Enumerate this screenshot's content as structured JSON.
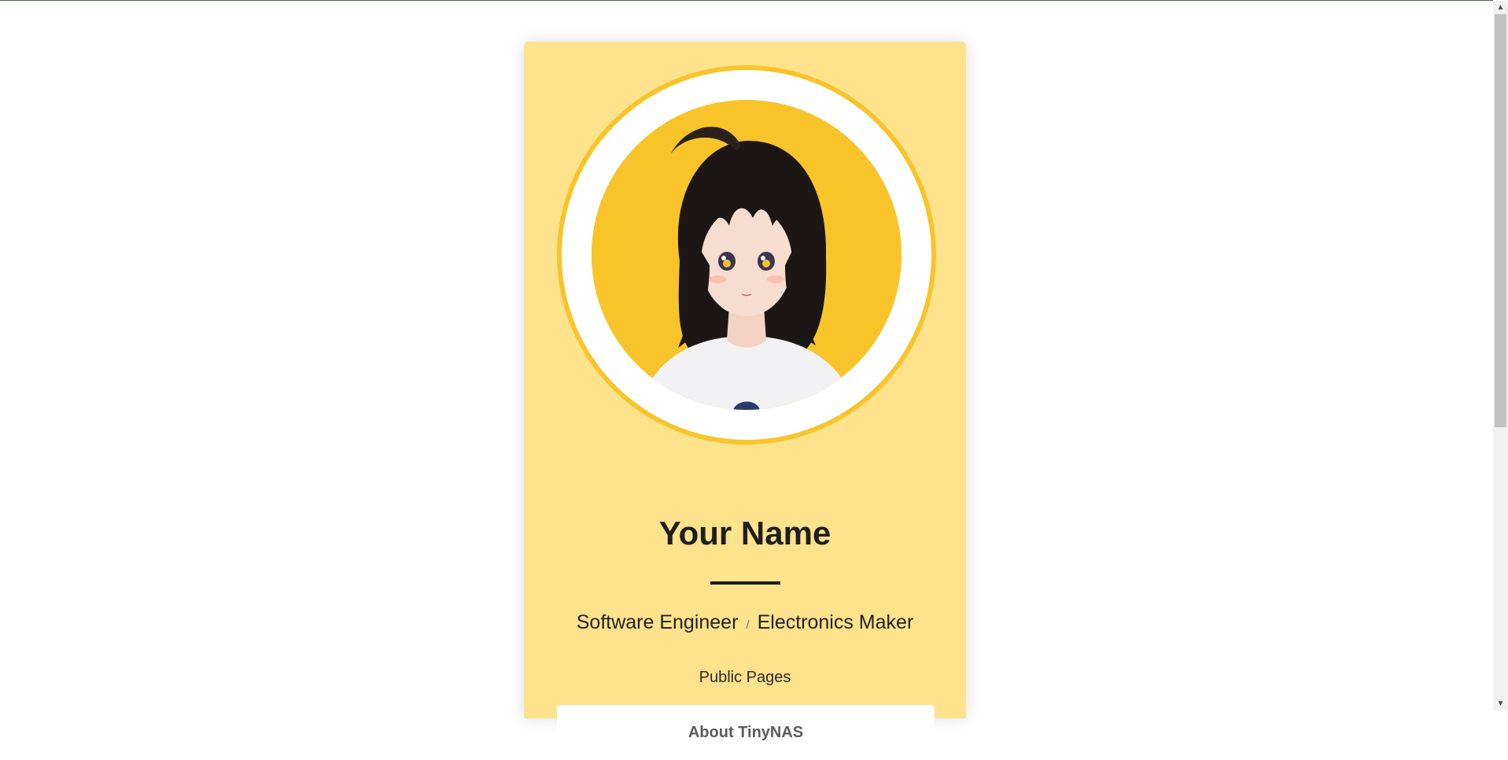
{
  "profile": {
    "name": "Your Name",
    "roles": [
      "Software Engineer",
      "Electronics Maker"
    ],
    "role_separator": "/",
    "avatar": "anime-girl-portrait"
  },
  "public_pages": {
    "heading": "Public Pages",
    "links": [
      {
        "label": "About TinyNAS"
      }
    ]
  },
  "colors": {
    "card_background": "#fee28c",
    "accent_yellow": "#f8c42a",
    "page_background": "#ffffff"
  },
  "scrollbar": {
    "up_icon": "scroll-up-arrow-icon",
    "down_icon": "scroll-down-arrow-icon"
  }
}
